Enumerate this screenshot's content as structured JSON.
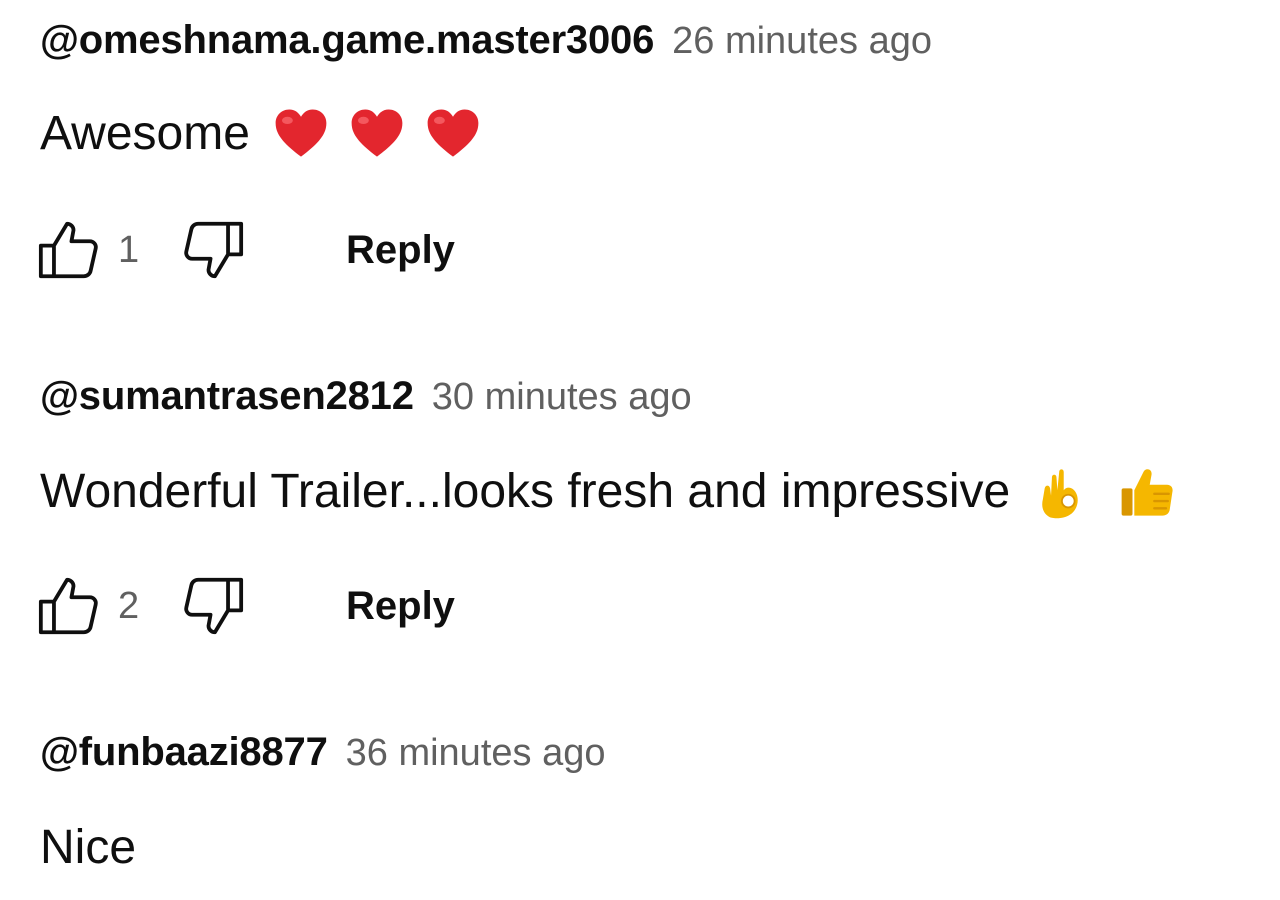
{
  "comments": [
    {
      "author": "@omeshnama.game.master3006",
      "time": "26 minutes ago",
      "text": "Awesome",
      "emojis": [
        "red-heart",
        "red-heart",
        "red-heart"
      ],
      "likes": "1",
      "reply_label": "Reply"
    },
    {
      "author": "@sumantrasen2812",
      "time": "30 minutes ago",
      "text": "Wonderful Trailer...looks fresh and impressive",
      "emojis": [
        "ok-hand",
        "thumbs-up"
      ],
      "likes": "2",
      "reply_label": "Reply"
    },
    {
      "author": "@funbaazi8877",
      "time": "36 minutes ago",
      "text": "Nice",
      "emojis": []
    }
  ],
  "colors": {
    "text_primary": "#0f0f0f",
    "text_secondary": "#606060",
    "heart": "#e3262e",
    "emoji_yellow": "#f5b700"
  }
}
